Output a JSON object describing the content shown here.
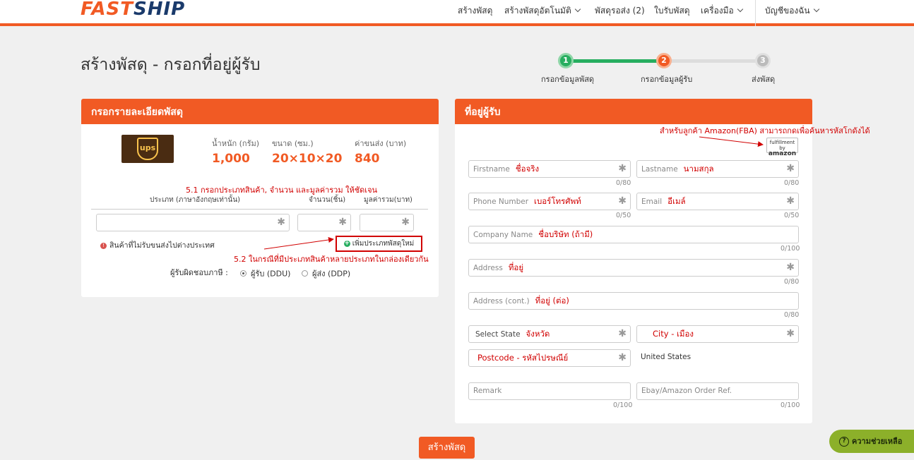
{
  "brand": {
    "logo_part1": "FAST",
    "logo_part2": "SHIP"
  },
  "nav": {
    "create_parcel": "สร้างพัสดุ",
    "create_auto": "สร้างพัสดุอัตโนมัติ",
    "pending": "พัสดุรอส่ง (2)",
    "receipt": "ใบรับพัสดุ",
    "tools": "เครื่องมือ",
    "account": "บัญชีของฉัน"
  },
  "page": {
    "title": "สร้างพัสดุ - กรอกที่อยู่ผู้รับ"
  },
  "stepper": {
    "steps": [
      {
        "num": "1",
        "label": "กรอกข้อมูลพัสดุ"
      },
      {
        "num": "2",
        "label": "กรอกข้อมูลผู้รับ"
      },
      {
        "num": "3",
        "label": "ส่งพัสดุ"
      }
    ],
    "colors": {
      "done": "#27ae60",
      "active": "#f15a24",
      "pending": "#bbbbbb"
    }
  },
  "left_panel": {
    "title": "กรอกรายละเอียดพัสดุ",
    "carrier_logo": "ups",
    "stats": [
      {
        "label": "น้ำหนัก (กรัม)",
        "value": "1,000"
      },
      {
        "label": "ขนาด (ซม.)",
        "value": "20×10×20"
      },
      {
        "label": "ค่าขนส่ง (บาท)",
        "value": "840"
      }
    ],
    "annotation_1": "5.1 กรอกประเภทสินค้า, จำนวน และมูลค่ารวม ให้ชัดเจน",
    "columns": {
      "type": "ประเภท (ภาษาอังกฤษเท่านั้น)",
      "qty": "จำนวน(ชิ้น)",
      "value": "มูลค่ารวม(บาท)"
    },
    "warning": "สินค้าที่ไม่รับขนส่งไปต่างประเทศ",
    "add_button": "เพิ่มประเภทพัสดุใหม่",
    "annotation_2": "5.2 ในกรณีที่มีประเภทสินค้าหลายประเภทในกล่องเดียวกัน",
    "duty_label": "ผู้รับผิดชอบภาษี :",
    "duty_options": [
      {
        "label": "ผู้รับ (DDU)",
        "selected": true
      },
      {
        "label": "ผู้ส่ง (DDP)",
        "selected": false
      }
    ]
  },
  "right_panel": {
    "title": "ที่อยู่ผู้รับ",
    "amazon_note": "สำหรับลูกค้า Amazon(FBA) สามารถกดเพื่อค้นหารหัสโกดังได้",
    "amazon_badge_small": "fulfillment by",
    "amazon_badge_big": "amazon",
    "fields": {
      "firstname": {
        "placeholder": "Firstname",
        "hint": "ชื่อจริง",
        "count": "0/80"
      },
      "lastname": {
        "placeholder": "Lastname",
        "hint": "นามสกุล",
        "count": "0/80"
      },
      "phone": {
        "placeholder": "Phone Number",
        "hint": "เบอร์โทรศัพท์",
        "count": "0/50"
      },
      "email": {
        "placeholder": "Email",
        "hint": "อีเมล์",
        "count": "0/50"
      },
      "company": {
        "placeholder": "Company Name",
        "hint": "ชื่อบริษัท (ถ้ามี)",
        "count": "0/100"
      },
      "address": {
        "placeholder": "Address",
        "hint": "ที่อยู่",
        "count": "0/80"
      },
      "address2": {
        "placeholder": "Address (cont.)",
        "hint": "ที่อยู่ (ต่อ)",
        "count": "0/80"
      },
      "state": {
        "placeholder": "Select State",
        "hint": "จังหวัด"
      },
      "city": {
        "hint": "City - เมือง"
      },
      "postcode": {
        "hint": "Postcode - รหัสไปรษณีย์"
      },
      "country": "United States",
      "remark": {
        "placeholder": "Remark",
        "count": "0/100"
      },
      "order_ref": {
        "placeholder": "Ebay/Amazon Order Ref.",
        "count": "0/100"
      }
    }
  },
  "submit": "สร้างพัสดุ",
  "help": "ความช่วยเหลือ",
  "colors": {
    "brand_orange": "#f15a24",
    "brand_navy": "#1a3a6b",
    "annotation_red": "#d10000",
    "help_green": "#8cb02a"
  }
}
